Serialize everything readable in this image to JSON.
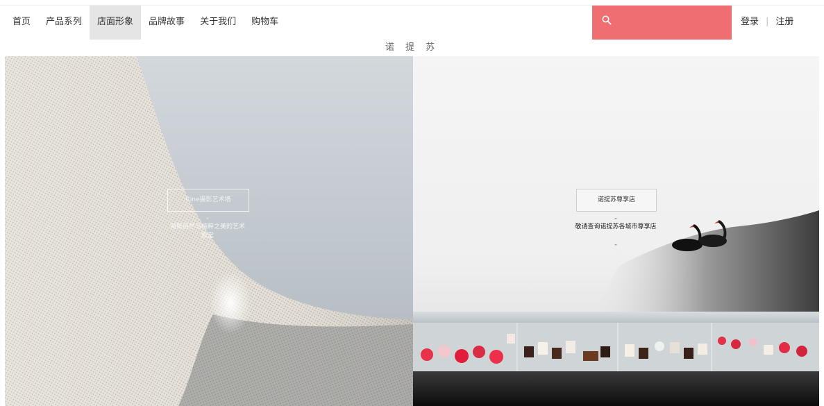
{
  "nav": {
    "items": [
      {
        "label": "首页"
      },
      {
        "label": "产品系列"
      },
      {
        "label": "店面形象"
      },
      {
        "label": "品牌故事"
      },
      {
        "label": "关于我们"
      },
      {
        "label": "购物车"
      }
    ],
    "active_index": 2
  },
  "search": {
    "icon": "search-icon",
    "color": "#ef6e72"
  },
  "auth": {
    "login": "登录",
    "separator": "|",
    "register": "注册"
  },
  "brand": {
    "title": "诺 提 苏"
  },
  "panels": {
    "left": {
      "title": "Cine摄影艺术墙",
      "dash": "-",
      "desc": "凝聚自然与纯粹之美的艺术殿堂",
      "dash_after": "-"
    },
    "right": {
      "title": "诺提苏尊享店",
      "dash": "-",
      "desc": "敬请查询诺提苏各城市尊享店",
      "dash_after": "-"
    }
  },
  "colors": {
    "accent": "#ef6e72",
    "active_bg": "#e5e5e5"
  }
}
